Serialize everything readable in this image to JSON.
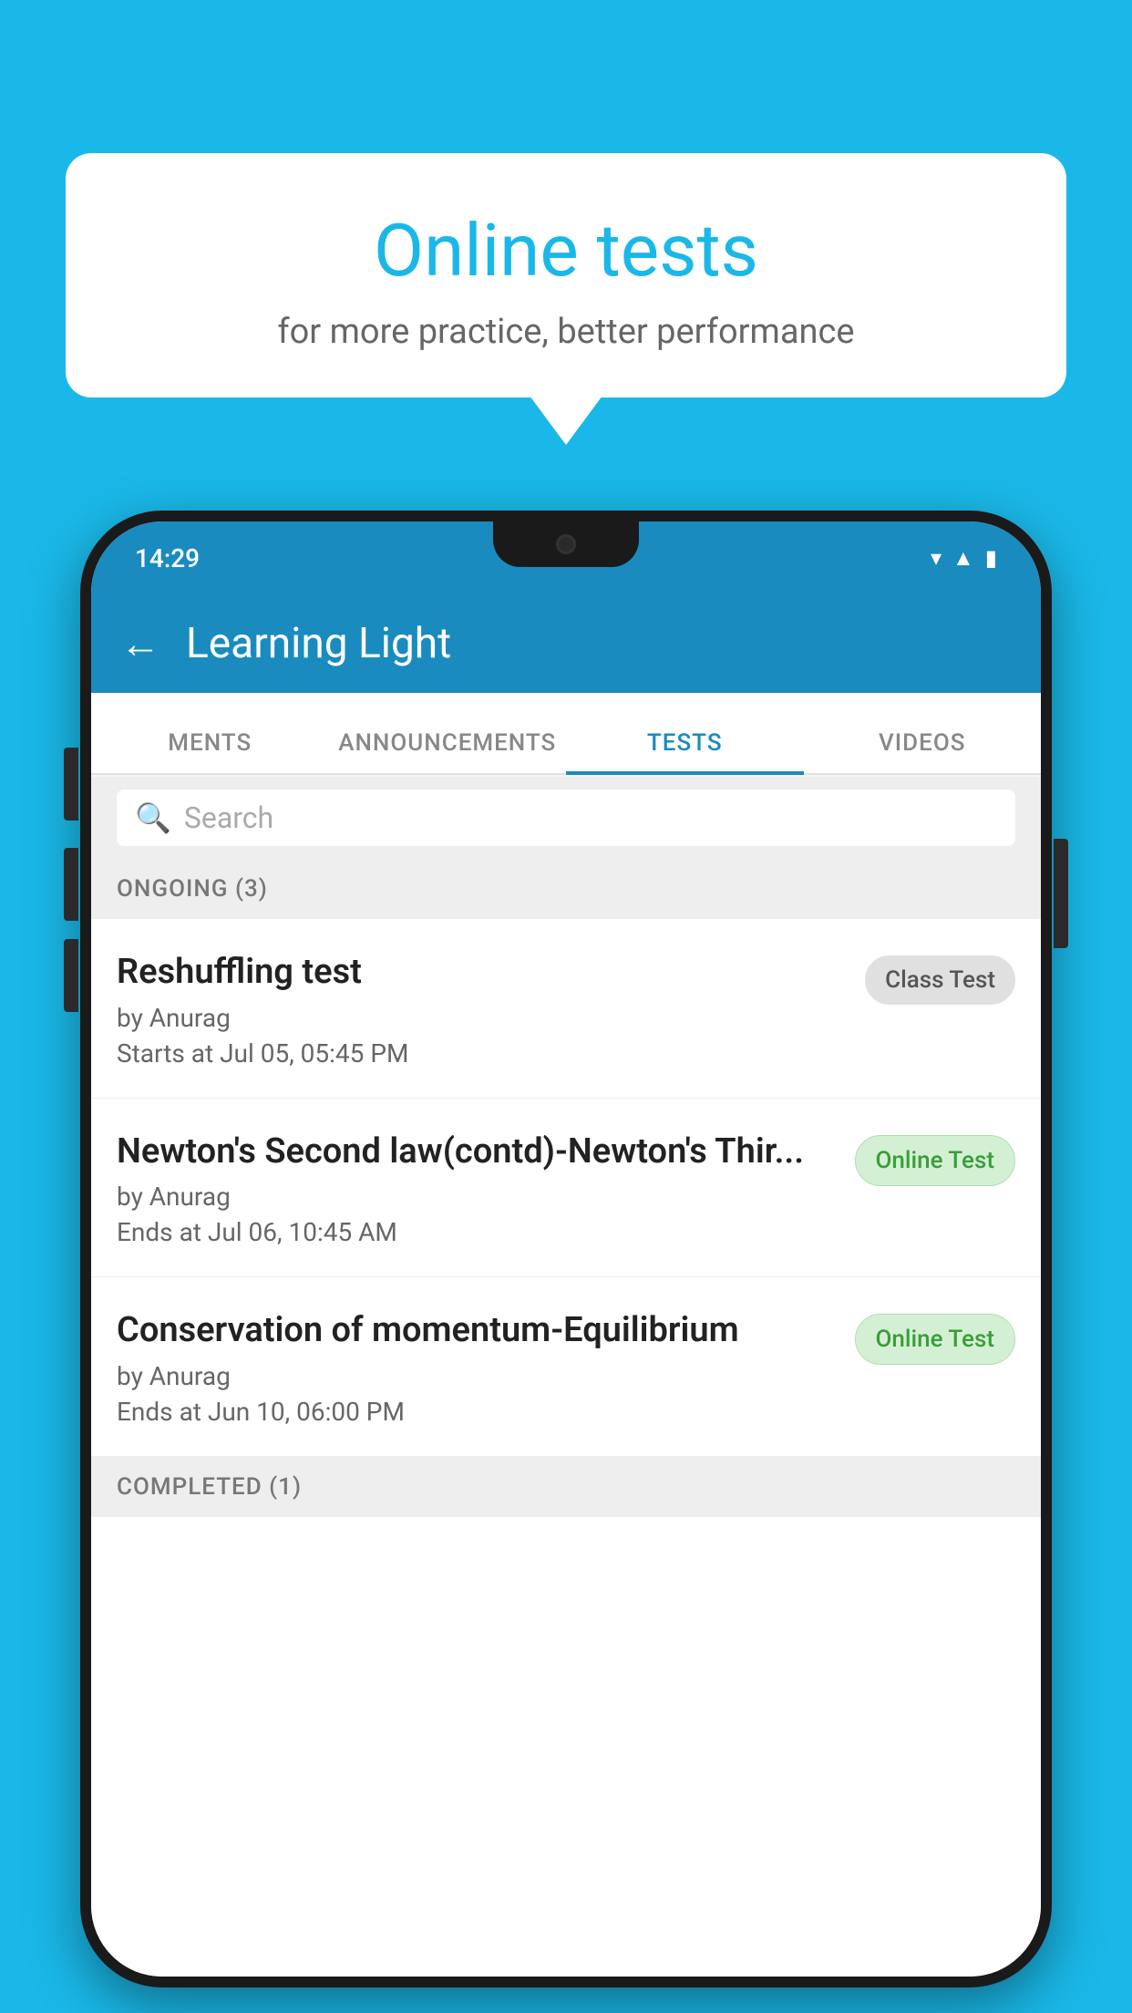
{
  "background_color": "#1ab8e8",
  "speech_bubble": {
    "title": "Online tests",
    "subtitle": "for more practice, better performance"
  },
  "phone": {
    "status_bar": {
      "time": "14:29",
      "icons": [
        "wifi",
        "signal",
        "battery"
      ]
    },
    "app_bar": {
      "title": "Learning Light",
      "back_label": "←"
    },
    "tabs": [
      {
        "label": "MENTS",
        "active": false
      },
      {
        "label": "ANNOUNCEMENTS",
        "active": false
      },
      {
        "label": "TESTS",
        "active": true
      },
      {
        "label": "VIDEOS",
        "active": false
      }
    ],
    "search": {
      "placeholder": "Search"
    },
    "ongoing_section": {
      "title": "ONGOING (3)"
    },
    "test_items": [
      {
        "name": "Reshuffling test",
        "author": "by Anurag",
        "date": "Starts at  Jul 05, 05:45 PM",
        "badge": "Class Test",
        "badge_type": "class"
      },
      {
        "name": "Newton's Second law(contd)-Newton's Thir...",
        "author": "by Anurag",
        "date": "Ends at  Jul 06, 10:45 AM",
        "badge": "Online Test",
        "badge_type": "online"
      },
      {
        "name": "Conservation of momentum-Equilibrium",
        "author": "by Anurag",
        "date": "Ends at  Jun 10, 06:00 PM",
        "badge": "Online Test",
        "badge_type": "online"
      }
    ],
    "completed_section": {
      "title": "COMPLETED (1)"
    }
  }
}
